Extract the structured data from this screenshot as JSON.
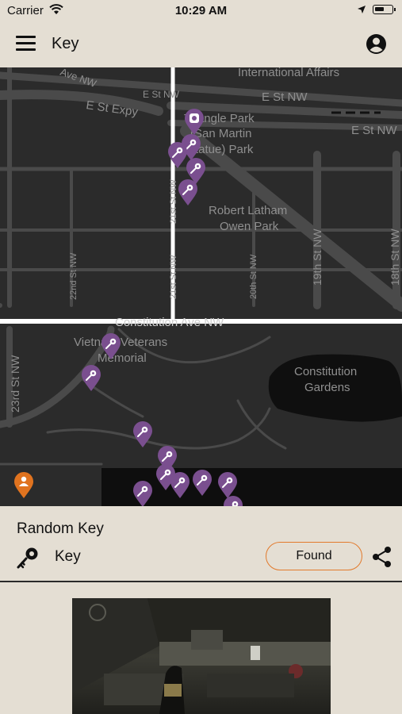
{
  "status_bar": {
    "carrier": "Carrier",
    "time": "10:29 AM",
    "battery_level": 0.6
  },
  "nav": {
    "title": "Key"
  },
  "map": {
    "labels": {
      "international_affairs": "International Affairs",
      "e_st_expy": "E St Expy",
      "e_st_nw_1": "E St NW",
      "e_st_nw_2": "E St NW",
      "e_st_nw_3": "E St NW",
      "triangle_park_1": "Triangle Park",
      "triangle_park_2": "(San Martin",
      "triangle_park_3": "Statue) Park",
      "robert_latham_1": "Robert Latham",
      "robert_latham_2": "Owen Park",
      "ave_nw": "Ave NW",
      "st_19th": "19th St NW",
      "st_18th": "18th St NW",
      "st_20th": "20th St NW",
      "st_21st": "21st St NW",
      "st_22nd": "22nd St NW",
      "st_23rd": "23rd St NW",
      "constitution_ave": "Constitution Ave NW",
      "vietnam_1": "Vietnam Veterans",
      "vietnam_2": "Memorial",
      "constitution_gardens_1": "Constitution",
      "constitution_gardens_2": "Gardens"
    }
  },
  "detail": {
    "name": "Random Key",
    "category": "Key",
    "found_label": "Found"
  },
  "colors": {
    "background": "#e4ded3",
    "map_bg": "#2b2b2b",
    "pin_purple": "#7a4f8f",
    "pin_orange": "#e0731f",
    "found_border": "#e27a2c"
  },
  "icons": [
    "menu-icon",
    "account-icon",
    "key-icon",
    "share-icon",
    "wifi-icon",
    "location-arrow-icon",
    "battery-icon"
  ]
}
